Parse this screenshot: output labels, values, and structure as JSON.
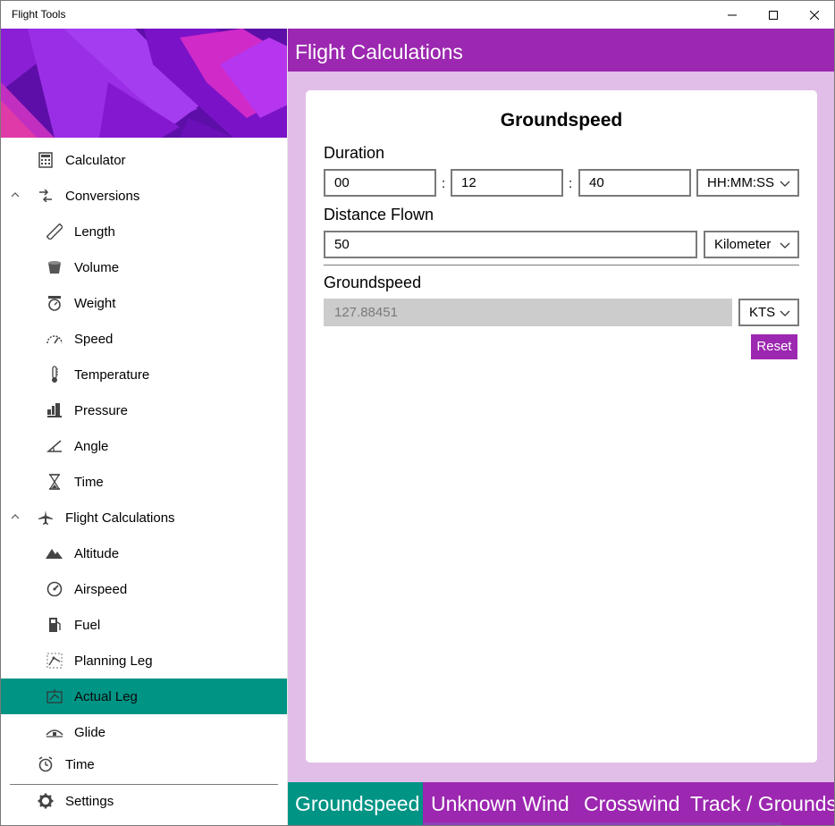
{
  "window": {
    "title": "Flight Tools",
    "minimize_icon": "minimize-icon",
    "maximize_icon": "maximize-icon",
    "close_icon": "close-icon"
  },
  "sidebar": {
    "items": [
      {
        "label": "Calculator",
        "icon": "calculator-icon"
      },
      {
        "label": "Conversions",
        "icon": "conversions-icon",
        "expanded": true
      },
      {
        "label": "Length",
        "icon": "ruler-icon"
      },
      {
        "label": "Volume",
        "icon": "volume-icon"
      },
      {
        "label": "Weight",
        "icon": "weight-icon"
      },
      {
        "label": "Speed",
        "icon": "speedometer-icon"
      },
      {
        "label": "Temperature",
        "icon": "thermometer-icon"
      },
      {
        "label": "Pressure",
        "icon": "pressure-icon"
      },
      {
        "label": "Angle",
        "icon": "angle-icon"
      },
      {
        "label": "Time",
        "icon": "hourglass-icon"
      },
      {
        "label": "Flight Calculations",
        "icon": "airplane-icon",
        "expanded": true
      },
      {
        "label": "Altitude",
        "icon": "mountain-icon"
      },
      {
        "label": "Airspeed",
        "icon": "gauge-icon"
      },
      {
        "label": "Fuel",
        "icon": "fuel-pump-icon"
      },
      {
        "label": "Planning Leg",
        "icon": "planning-leg-icon"
      },
      {
        "label": "Actual Leg",
        "icon": "actual-leg-icon",
        "selected": true
      },
      {
        "label": "Glide",
        "icon": "glide-icon"
      },
      {
        "label": "Time",
        "icon": "alarm-clock-icon"
      },
      {
        "label": "Settings",
        "icon": "gear-icon"
      }
    ]
  },
  "header": {
    "title": "Flight Calculations"
  },
  "card": {
    "title": "Groundspeed",
    "duration": {
      "label": "Duration",
      "hours": "00",
      "minutes": "12",
      "seconds": "40",
      "separator": ":",
      "format": "HH:MM:SS"
    },
    "distance": {
      "label": "Distance Flown",
      "value": "50",
      "unit": "Kilometer"
    },
    "result": {
      "label": "Groundspeed",
      "value": "127.88451",
      "unit": "KTS"
    },
    "reset_label": "Reset"
  },
  "tabs": [
    {
      "label": "Groundspeed",
      "active": true
    },
    {
      "label": "Unknown Wind"
    },
    {
      "label": "Crosswind"
    },
    {
      "label": "Track / Groundspeed"
    }
  ],
  "colors": {
    "accent": "#9c27b0",
    "selected": "#009485",
    "content_bg": "#e1bee7"
  }
}
